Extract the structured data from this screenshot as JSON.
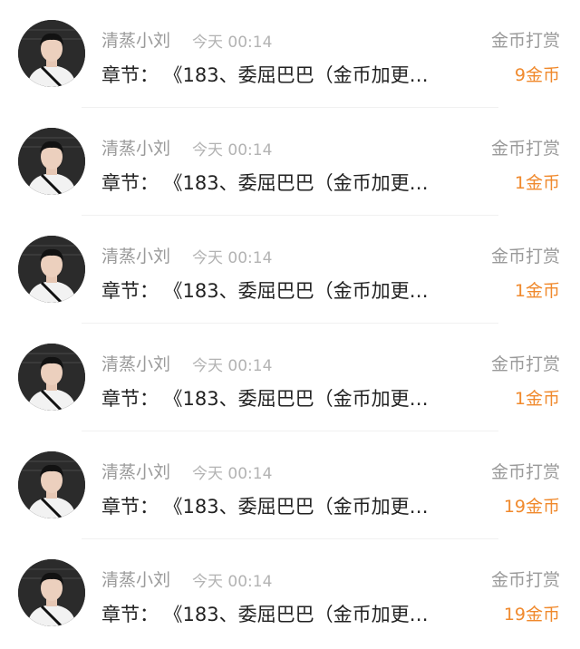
{
  "records": [
    {
      "user": "清蒸小刘",
      "time": "今天 00:14",
      "type": "金币打赏",
      "chapter_prefix": "章节：",
      "chapter": "《183、委屈巴巴（金币加更…",
      "amount": "9金币"
    },
    {
      "user": "清蒸小刘",
      "time": "今天 00:14",
      "type": "金币打赏",
      "chapter_prefix": "章节：",
      "chapter": "《183、委屈巴巴（金币加更…",
      "amount": "1金币"
    },
    {
      "user": "清蒸小刘",
      "time": "今天 00:14",
      "type": "金币打赏",
      "chapter_prefix": "章节：",
      "chapter": "《183、委屈巴巴（金币加更…",
      "amount": "1金币"
    },
    {
      "user": "清蒸小刘",
      "time": "今天 00:14",
      "type": "金币打赏",
      "chapter_prefix": "章节：",
      "chapter": "《183、委屈巴巴（金币加更…",
      "amount": "1金币"
    },
    {
      "user": "清蒸小刘",
      "time": "今天 00:14",
      "type": "金币打赏",
      "chapter_prefix": "章节：",
      "chapter": "《183、委屈巴巴（金币加更…",
      "amount": "19金币"
    },
    {
      "user": "清蒸小刘",
      "time": "今天 00:14",
      "type": "金币打赏",
      "chapter_prefix": "章节：",
      "chapter": "《183、委屈巴巴（金币加更…",
      "amount": "19金币"
    }
  ],
  "colors": {
    "amount": "#f0892c",
    "meta": "#9a9a9a",
    "text": "#222222"
  }
}
